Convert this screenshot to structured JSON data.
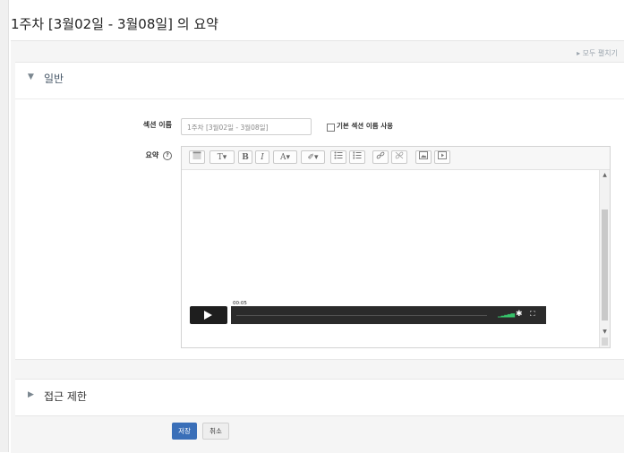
{
  "page": {
    "title": "1주차 [3월02일 - 3월08일] 의 요약"
  },
  "card": {
    "expand_all_label": "모두 펼치기"
  },
  "general_section": {
    "title": "일반",
    "section_name_label": "섹션 이름",
    "section_name_value": "1주차 [3월02일 - 3월08일]",
    "use_default_name_label": "기본 섹션 이름 사용",
    "summary_label": "요약",
    "help_glyph": "?"
  },
  "editor_toolbar": {
    "icons": [
      "collapse-icon",
      "paragraph-styles-icon",
      "bold-icon",
      "italic-icon",
      "font-color-icon",
      "highlight-icon",
      "unordered-list-icon",
      "ordered-list-icon",
      "link-icon",
      "unlink-icon",
      "image-icon",
      "media-icon"
    ],
    "paragraph_styles": "T▾",
    "bold": "B",
    "italic": "I",
    "font_color": "A▾",
    "highlight": "✐▾"
  },
  "video_player": {
    "time": "00:05"
  },
  "access_section": {
    "title": "접근 제한"
  },
  "buttons": {
    "save": "저장",
    "cancel": "취소"
  },
  "colors": {
    "primary": "#3a6fb8",
    "player_bg": "#2b2b2b",
    "volume": "#36c26a"
  }
}
